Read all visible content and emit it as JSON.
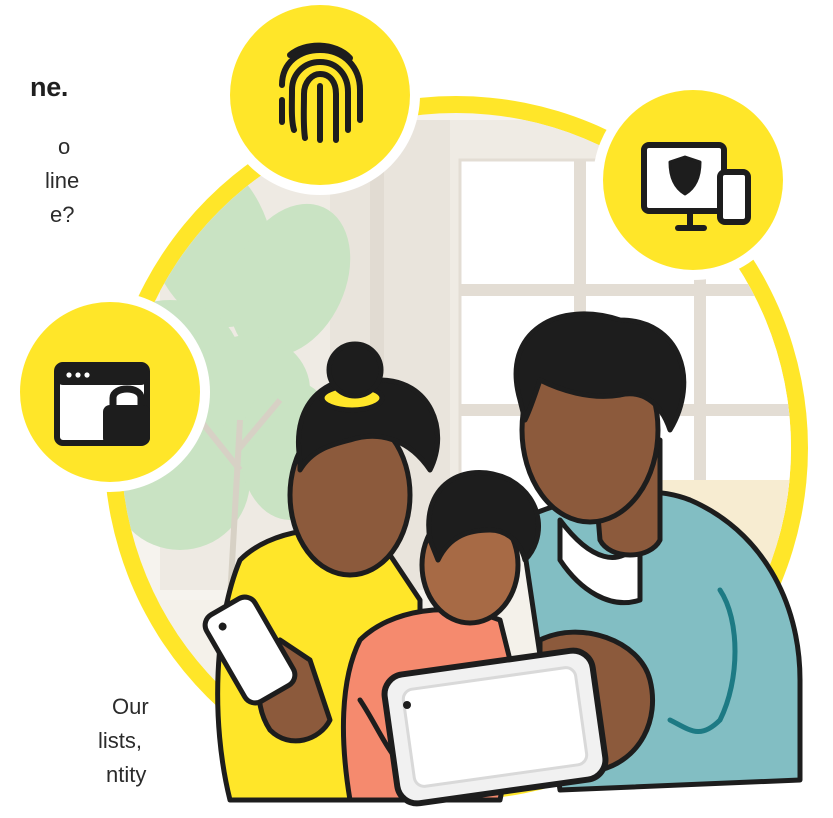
{
  "hero": {
    "heading_fragment": "ne.",
    "intro_lines": [
      "o",
      "line",
      "e?"
    ],
    "body_lines": [
      "Our",
      "lists,",
      "ntity"
    ]
  },
  "icons": {
    "fingerprint": "fingerprint-icon",
    "device_security": "shield-monitor-phone-icon",
    "browser_lock": "browser-lock-icon"
  },
  "colors": {
    "accent_yellow": "#FFE629",
    "outline": "#1d1d1d",
    "skin": "#8C5A3C",
    "jacket": "#82BEC3",
    "shirt_coral": "#F58A6E"
  }
}
